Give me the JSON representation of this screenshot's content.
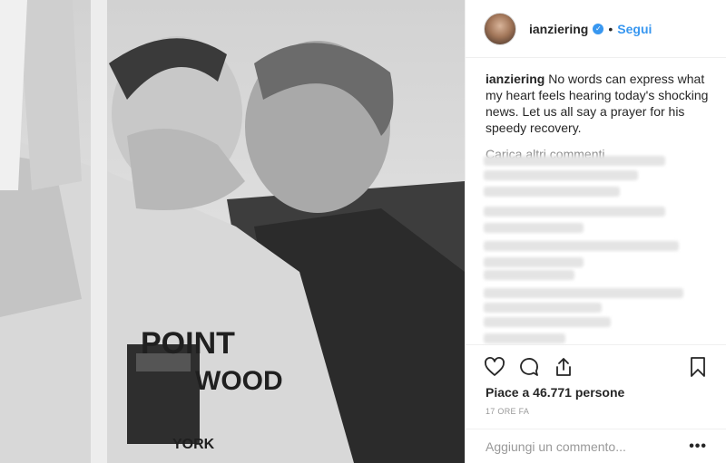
{
  "post": {
    "username": "ianziering",
    "verified_icon": "verified-badge-icon",
    "separator": "•",
    "follow_label": "Segui",
    "caption_user": "ianziering",
    "caption_text": "No words can express what my heart feels hearing today's shocking news. Let us all say a prayer for his speedy recovery.",
    "load_more_label": "Carica altri commenti",
    "likes_label": "Piace a 46.771 persone",
    "time_label": "17 ORE FA",
    "comment_placeholder": "Aggiungi un commento...",
    "more_label": "•••"
  },
  "photo": {
    "sweatshirt_text_top": "POINT",
    "sweatshirt_text_bottom": "WOOD",
    "sweatshirt_text_small": "YORK"
  },
  "icons": [
    "heart-icon",
    "comment-icon",
    "share-icon",
    "bookmark-icon"
  ],
  "colors": {
    "accent": "#3897f0",
    "text": "#262626",
    "muted": "#8e8e8e"
  }
}
